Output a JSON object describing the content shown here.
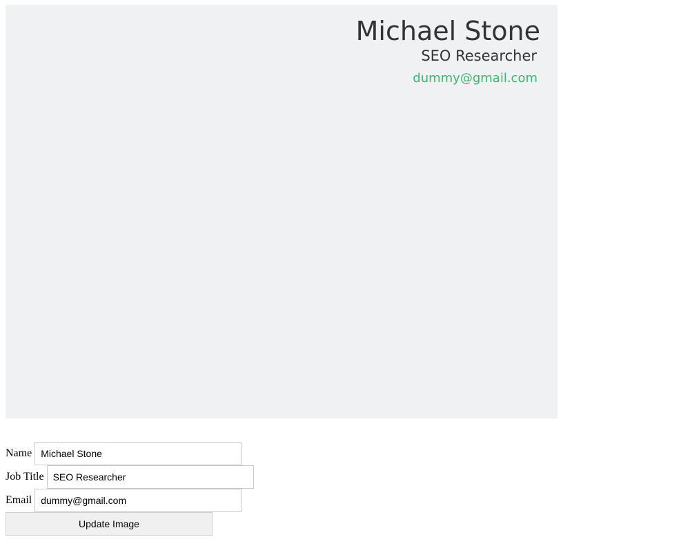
{
  "card": {
    "name": "Michael Stone",
    "job_title": "SEO Researcher",
    "email": "dummy@gmail.com"
  },
  "form": {
    "name_label": "Name",
    "name_value": "Michael Stone",
    "job_title_label": "Job Title",
    "job_title_value": "SEO Researcher",
    "email_label": "Email",
    "email_value": "dummy@gmail.com",
    "submit_label": "Update Image"
  },
  "colors": {
    "card_background": "#f0f1f3",
    "name_text": "#333333",
    "job_title_text": "#333333",
    "email_text": "#3cb371"
  }
}
